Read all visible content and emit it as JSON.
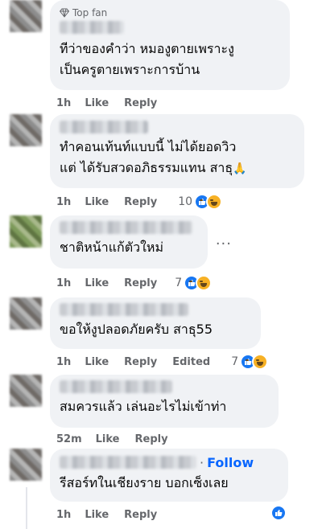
{
  "comments": [
    {
      "badge": "Top fan",
      "badge_icon": "diamond-icon",
      "lines": [
        "ทีว่าของคำว่า หมองูตายเพราะงู",
        "เป็นครูตายเพราะการบ้าน"
      ],
      "time": "1h",
      "like": "Like",
      "reply": "Reply"
    },
    {
      "lines": [
        "ทำคอนเท้นท์แบบนี้ ไม่ได้ยอดวิว",
        "แต่ ได้รับสวดอภิธรรมแทน สาธุ"
      ],
      "emoji": "🙏",
      "time": "1h",
      "like": "Like",
      "reply": "Reply",
      "reaction_count": "10",
      "reactions": [
        "like",
        "haha"
      ]
    },
    {
      "lines": [
        "ชาติหน้าแก้ตัวใหม่"
      ],
      "more": "...",
      "time": "1h",
      "like": "Like",
      "reply": "Reply",
      "reaction_count": "7",
      "reactions": [
        "like",
        "haha"
      ]
    },
    {
      "lines": [
        "ขอให้งูปลอดภัยครับ สาธุ55"
      ],
      "time": "1h",
      "like": "Like",
      "reply": "Reply",
      "edited": "Edited",
      "reaction_count": "7",
      "reactions": [
        "like",
        "haha"
      ]
    },
    {
      "lines": [
        "สมควรแล้ว เล่นอะไรไม่เข้าท่า"
      ],
      "time": "52m",
      "like": "Like",
      "reply": "Reply"
    },
    {
      "follow_sep": "·",
      "follow": "Follow",
      "lines": [
        "รีสอร์ทในเชียงราย บอกเซ็งเลย"
      ],
      "time": "1h",
      "like": "Like",
      "reply": "Reply",
      "reactions": [
        "like"
      ]
    }
  ],
  "colors": {
    "bubble": "#f0f2f5",
    "like_blue": "#1877f2",
    "haha_yellow": "#f7b125",
    "follow_blue": "#0866ff",
    "meta_gray": "#65676b"
  }
}
